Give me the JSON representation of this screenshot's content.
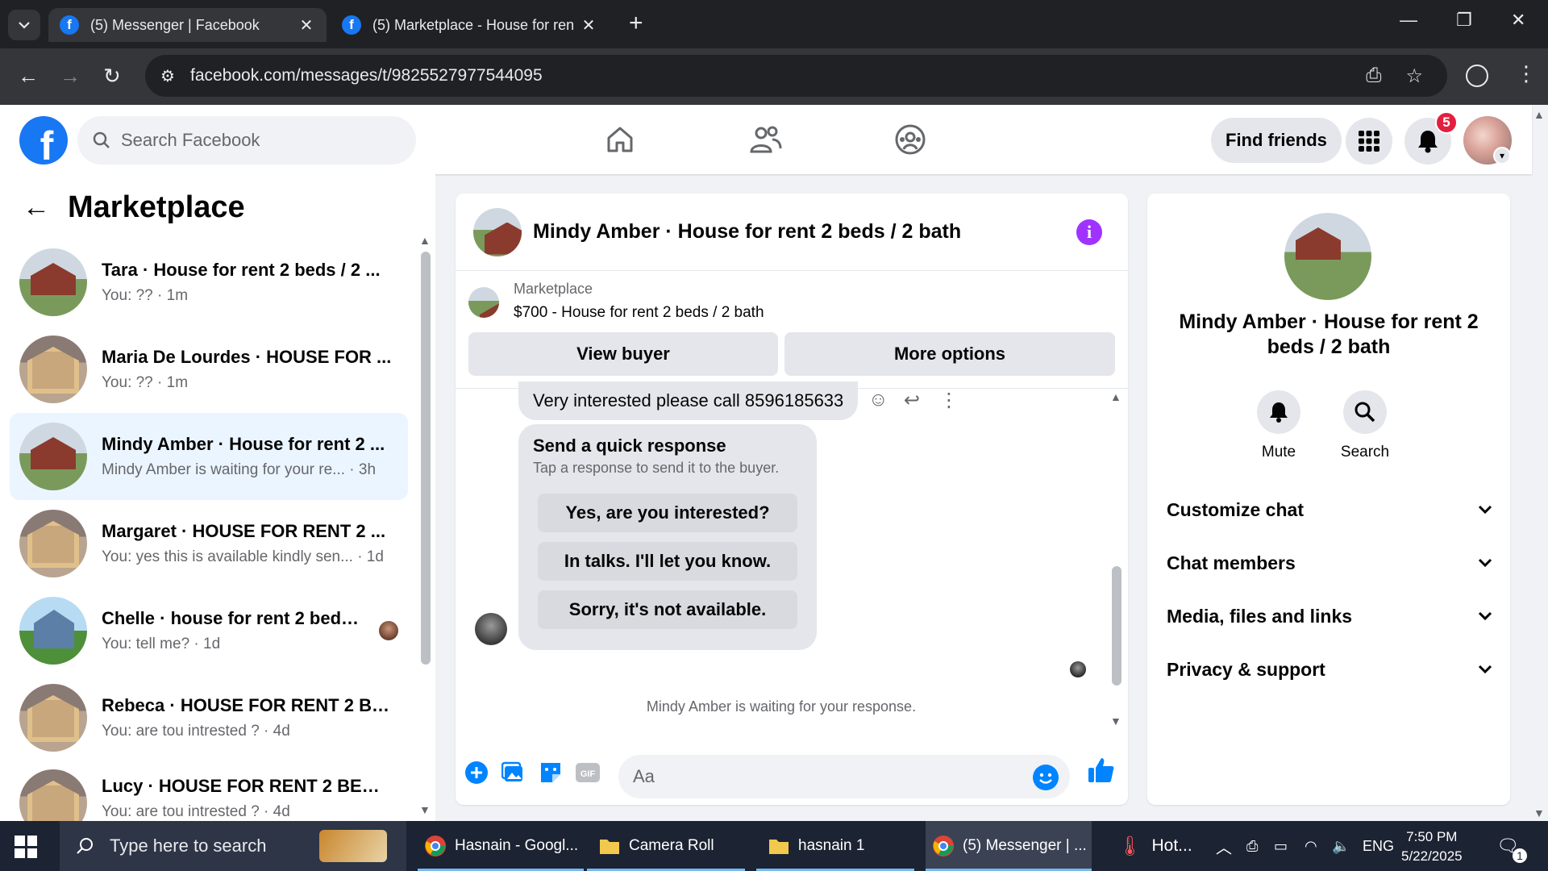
{
  "browser": {
    "tabs": [
      {
        "title": "(5) Messenger | Facebook",
        "active": true
      },
      {
        "title": "(5) Marketplace - House for ren",
        "active": false
      }
    ],
    "url": "facebook.com/messages/t/9825527977544095"
  },
  "fb": {
    "logo": "f",
    "search_placeholder": "Search Facebook",
    "find_friends": "Find friends",
    "notification_count": "5",
    "brand_color": "#1877f2"
  },
  "left": {
    "title": "Marketplace",
    "conversations": [
      {
        "name": "Tara · House for rent 2 beds / 2 ...",
        "preview": "You: ?? · 1m"
      },
      {
        "name": "Maria De Lourdes · HOUSE FOR ...",
        "preview": "You: ?? · 1m"
      },
      {
        "name": "Mindy Amber · House for rent 2 ...",
        "preview": "Mindy Amber is waiting for your re... · 3h"
      },
      {
        "name": "Margaret · HOUSE FOR RENT 2 ...",
        "preview": "You: yes this is available kindly sen... · 1d"
      },
      {
        "name": "Chelle · house for rent 2 beds ...",
        "preview": "You: tell me? · 1d"
      },
      {
        "name": "Rebeca · HOUSE FOR RENT 2 BE...",
        "preview": "You: are tou intrested ? · 4d"
      },
      {
        "name": "Lucy · HOUSE FOR RENT 2 BEDS...",
        "preview": "You: are tou intrested ? · 4d"
      }
    ]
  },
  "chat": {
    "title": "Mindy Amber · House for rent 2 beds / 2 bath",
    "listing_label": "Marketplace",
    "listing_price": "$700 - House for rent 2 beds / 2 bath",
    "view_buyer": "View buyer",
    "more_options": "More options",
    "message": "Very interested please call 8596185633",
    "quick_title": "Send a quick response",
    "quick_sub": "Tap a response to send it to the buyer.",
    "quick_responses": [
      "Yes, are you interested?",
      "In talks. I'll let you know.",
      "Sorry, it's not available."
    ],
    "waiting": "Mindy Amber is waiting for your response.",
    "composer_placeholder": "Aa",
    "accent": "#0084ff"
  },
  "right": {
    "name": "Mindy Amber · House for rent 2 beds / 2 bath",
    "mute": "Mute",
    "search": "Search",
    "sections": [
      "Customize chat",
      "Chat members",
      "Media, files and links",
      "Privacy & support"
    ]
  },
  "taskbar": {
    "search_placeholder": "Type here to search",
    "apps": [
      "Hasnain - Googl...",
      "Camera Roll",
      "hasnain 1",
      "(5) Messenger | ..."
    ],
    "weather": "Hot...",
    "lang": "ENG",
    "time": "7:50 PM",
    "date": "5/22/2025",
    "notif_count": "1"
  }
}
